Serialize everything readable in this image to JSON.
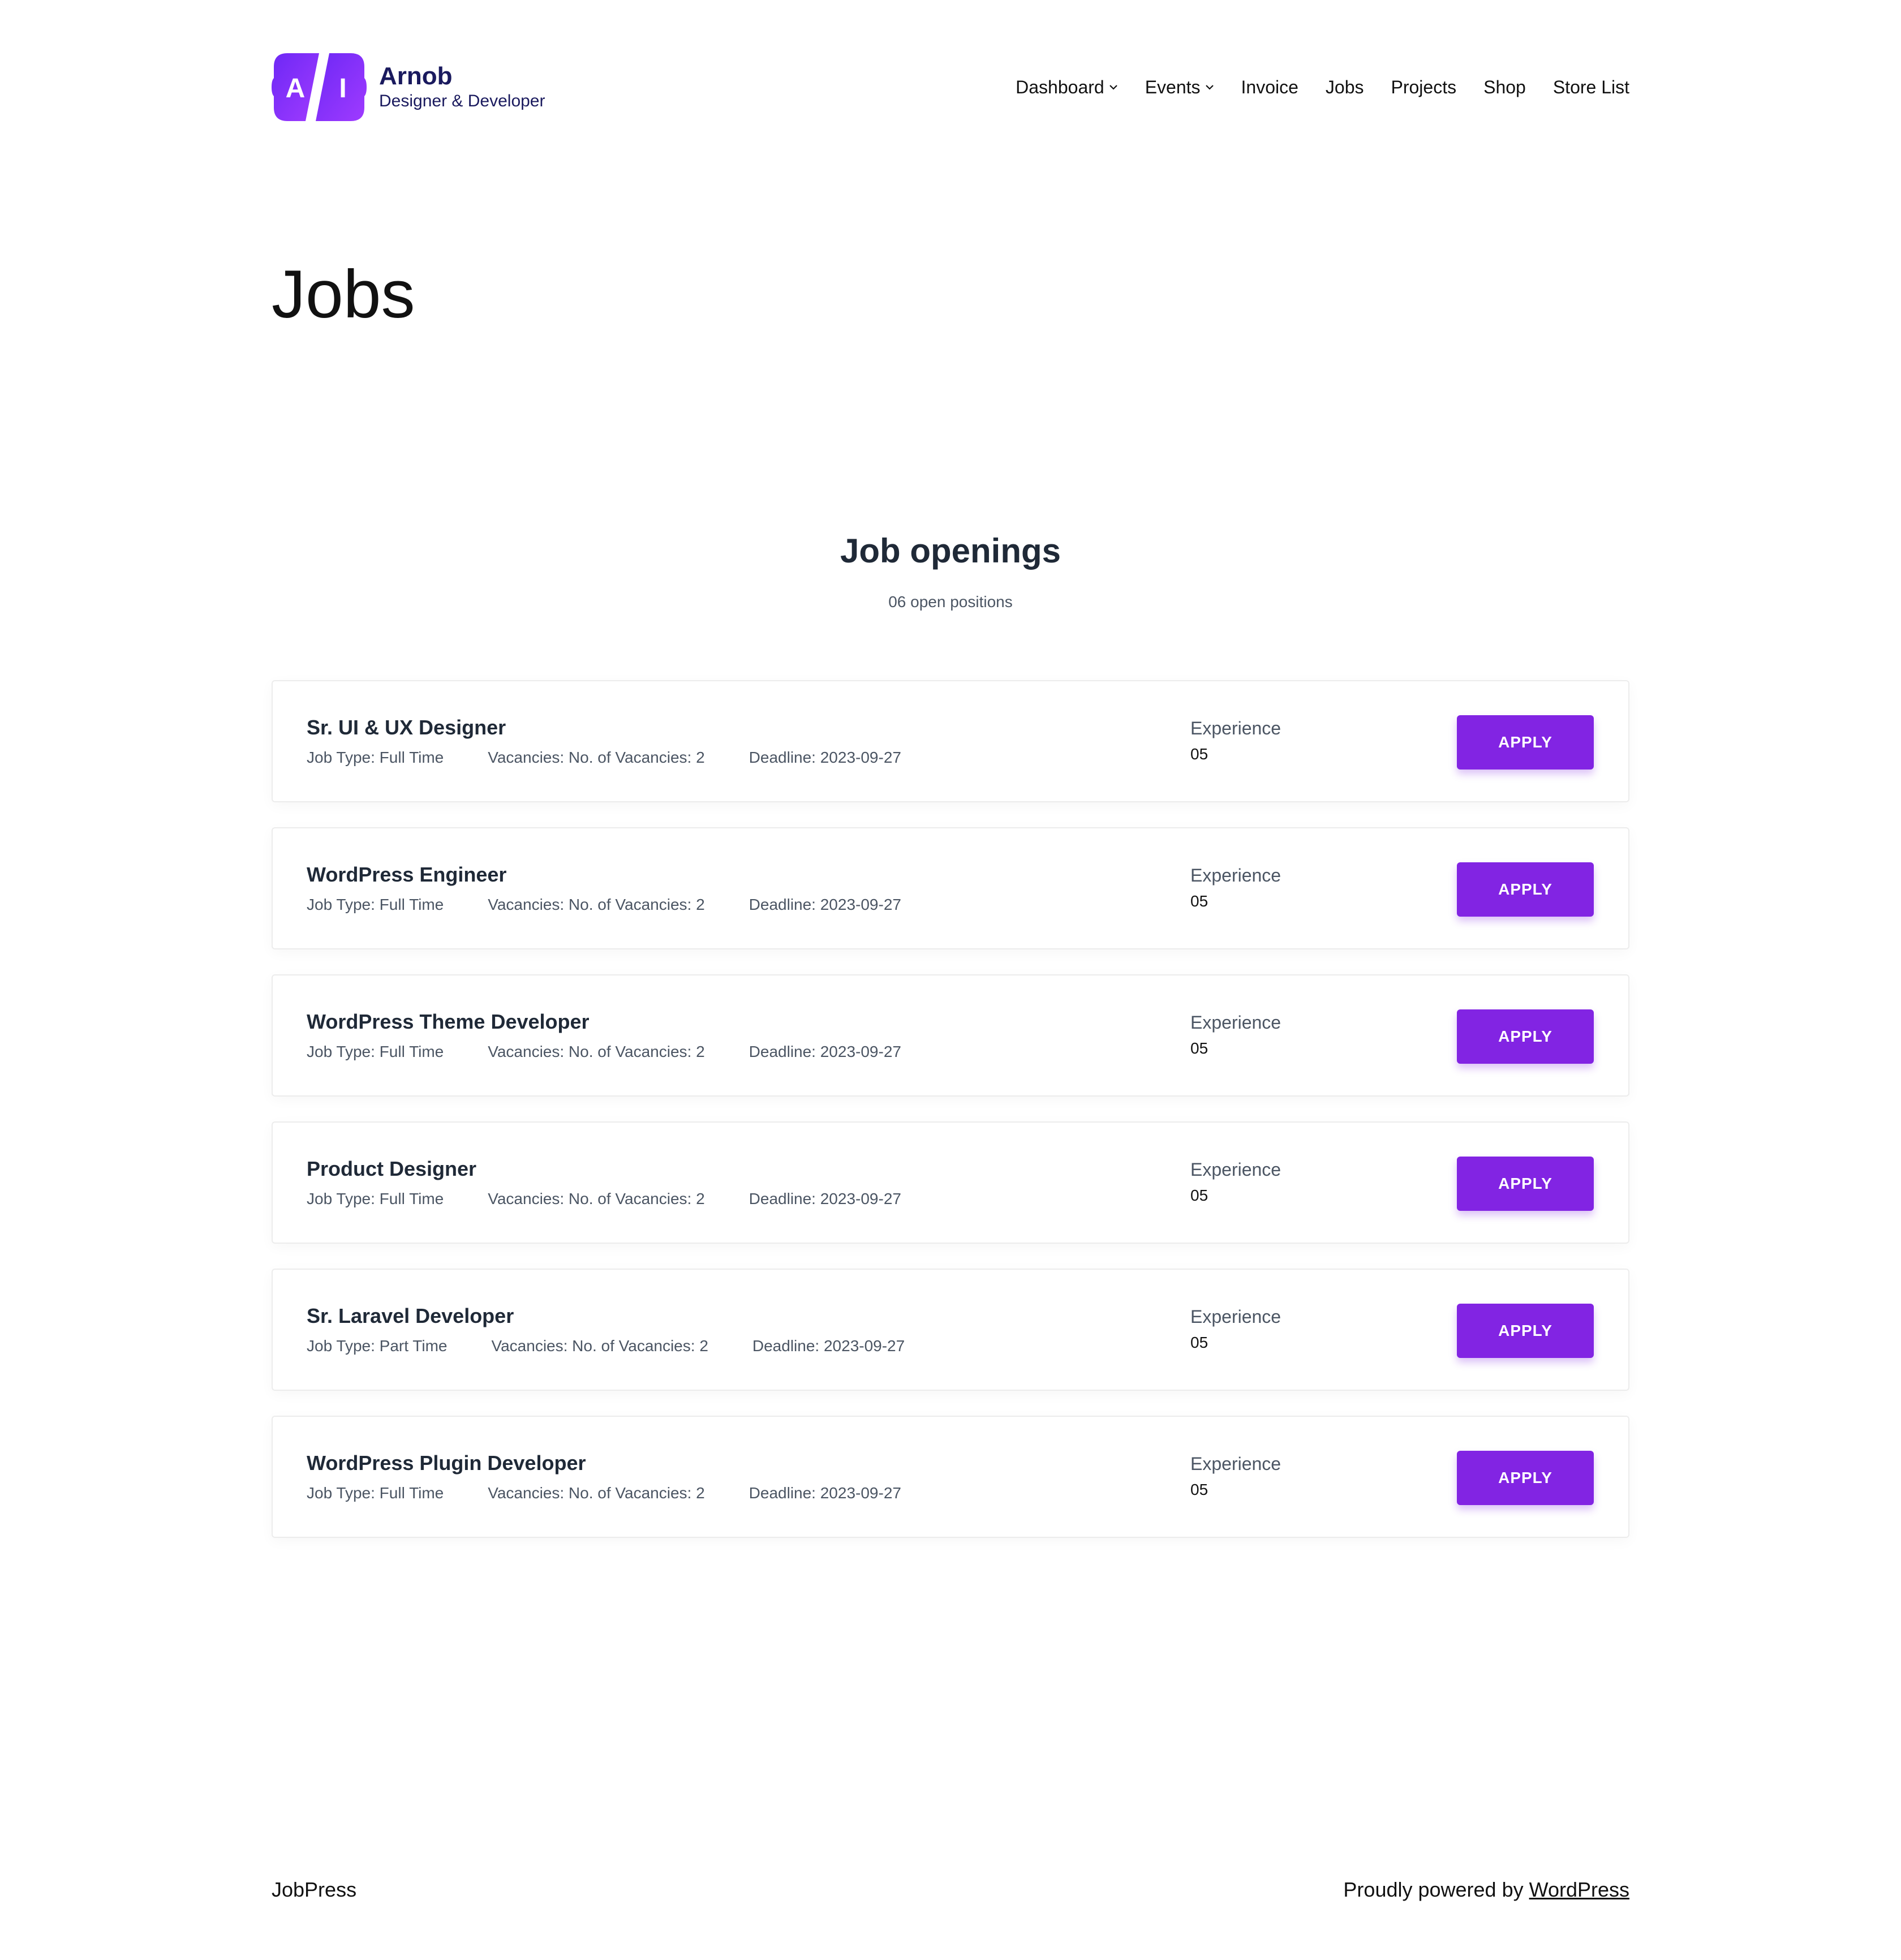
{
  "brand": {
    "logo_letters": [
      "A",
      "I"
    ],
    "name": "Arnob",
    "tagline": "Designer & Developer",
    "gradient": [
      "#7b2ff7",
      "#9b35ff"
    ]
  },
  "nav": {
    "items": [
      {
        "label": "Dashboard",
        "has_dropdown": true
      },
      {
        "label": "Events",
        "has_dropdown": true
      },
      {
        "label": "Invoice",
        "has_dropdown": false
      },
      {
        "label": "Jobs",
        "has_dropdown": false
      },
      {
        "label": "Projects",
        "has_dropdown": false
      },
      {
        "label": "Shop",
        "has_dropdown": false
      },
      {
        "label": "Store List",
        "has_dropdown": false
      }
    ]
  },
  "page": {
    "title": "Jobs"
  },
  "section": {
    "title": "Job openings",
    "subtitle": "06 open positions"
  },
  "jobs": [
    {
      "title": "Sr. UI & UX Designer",
      "job_type": "Job Type: Full Time",
      "vacancies": "Vacancies: No. of Vacancies: 2",
      "deadline": "Deadline: 2023-09-27",
      "experience_label": "Experience",
      "experience_value": "05",
      "apply_label": "APPLY"
    },
    {
      "title": "WordPress Engineer",
      "job_type": "Job Type: Full Time",
      "vacancies": "Vacancies: No. of Vacancies: 2",
      "deadline": "Deadline: 2023-09-27",
      "experience_label": "Experience",
      "experience_value": "05",
      "apply_label": "APPLY"
    },
    {
      "title": "WordPress Theme Developer",
      "job_type": "Job Type: Full Time",
      "vacancies": "Vacancies: No. of Vacancies: 2",
      "deadline": "Deadline: 2023-09-27",
      "experience_label": "Experience",
      "experience_value": "05",
      "apply_label": "APPLY"
    },
    {
      "title": "Product Designer",
      "job_type": "Job Type: Full Time",
      "vacancies": "Vacancies: No. of Vacancies: 2",
      "deadline": "Deadline: 2023-09-27",
      "experience_label": "Experience",
      "experience_value": "05",
      "apply_label": "APPLY"
    },
    {
      "title": "Sr. Laravel Developer",
      "job_type": "Job Type: Part Time",
      "vacancies": "Vacancies: No. of Vacancies: 2",
      "deadline": "Deadline: 2023-09-27",
      "experience_label": "Experience",
      "experience_value": "05",
      "apply_label": "APPLY"
    },
    {
      "title": "WordPress Plugin Developer",
      "job_type": "Job Type: Full Time",
      "vacancies": "Vacancies: No. of Vacancies: 2",
      "deadline": "Deadline: 2023-09-27",
      "experience_label": "Experience",
      "experience_value": "05",
      "apply_label": "APPLY"
    }
  ],
  "footer": {
    "site_name": "JobPress",
    "powered_prefix": "Proudly powered by ",
    "powered_link": "WordPress"
  },
  "colors": {
    "accent": "#8224e3",
    "heading": "#1f2937",
    "muted": "#4b5563",
    "brand_text": "#1a1a5e"
  },
  "icons": {
    "dropdown": "chevron-down-icon"
  }
}
